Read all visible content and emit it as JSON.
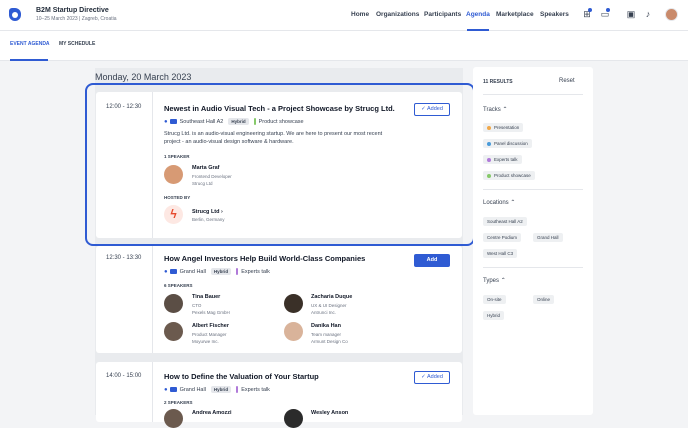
{
  "header": {
    "event_title": "B2M Startup Directive",
    "event_subtitle": "10–25 March 2023 | Zagreb, Croatia",
    "nav": [
      "Home",
      "Organizations",
      "Participants",
      "Agenda",
      "Marketplace",
      "Speakers"
    ],
    "active_nav": "Agenda"
  },
  "subnav": {
    "tabs": [
      "EVENT AGENDA",
      "MY SCHEDULE"
    ]
  },
  "day_heading": "Monday, 20 March 2023",
  "sessions": [
    {
      "time": "12:00 - 12:30",
      "title": "Newest in Audio Visual Tech - a Project Showcase by Strucg Ltd.",
      "location": "Southeast Hall A2",
      "type": "Hybrid",
      "track": "Product showcase",
      "track_color": "#86c96a",
      "button": "Added",
      "description": "Strucg Ltd. is an audio-visual engineering startup. We are here to present our most recent project - an audio-visual design software & hardware.",
      "speakers_label": "1 SPEAKER",
      "speakers": [
        {
          "name": "Marta Graf",
          "role": "Frontend Developer",
          "org": "Strucg Ltd"
        }
      ],
      "hosted_label": "HOSTED BY",
      "host": {
        "name": "Strucg Ltd",
        "location": "Berlin, Germany"
      }
    },
    {
      "time": "12:30 - 13:30",
      "title": "How Angel Investors Help Build World-Class Companies",
      "location": "Grand Hall",
      "type": "Hybrid",
      "track": "Experts talk",
      "track_color": "#b07ad9",
      "button": "Add",
      "speakers_label": "6 SPEAKERS",
      "speakers": [
        {
          "name": "Tina Bauer",
          "role": "CTO",
          "org": "Pexels Mag GmbH"
        },
        {
          "name": "Zacharia Duque",
          "role": "UX & UI Designer",
          "org": "Antrunci Inc."
        },
        {
          "name": "Albert Fischer",
          "role": "Product Manager",
          "org": "Moyurwe Inc."
        },
        {
          "name": "Danika Han",
          "role": "Team manager",
          "org": "Armunt Design Co"
        }
      ]
    },
    {
      "time": "14:00 - 15:00",
      "title": "How to Define the Valuation of Your Startup",
      "location": "Grand Hall",
      "type": "Hybrid",
      "track": "Experts talk",
      "track_color": "#b07ad9",
      "button": "Added",
      "speakers_label": "2 SPEAKERS",
      "speakers": [
        {
          "name": "Andrea Amozzi",
          "role": "",
          "org": ""
        },
        {
          "name": "Wesley Anson",
          "role": "",
          "org": ""
        }
      ]
    }
  ],
  "filters": {
    "results": "11 RESULTS",
    "reset": "Reset",
    "tracks_label": "Tracks",
    "tracks": [
      {
        "name": "Presentation",
        "color": "#f0a84a"
      },
      {
        "name": "Panel discussion",
        "color": "#4a9bd9"
      },
      {
        "name": "Experts talk",
        "color": "#b07ad9"
      },
      {
        "name": "Product showcase",
        "color": "#86c96a"
      }
    ],
    "locations_label": "Locations",
    "locations": [
      "Southeast Hall A2",
      "Centre Podium",
      "Grand Hall",
      "West Hall C3"
    ],
    "types_label": "Types",
    "types": [
      "On-site",
      "Online",
      "Hybrid"
    ]
  }
}
